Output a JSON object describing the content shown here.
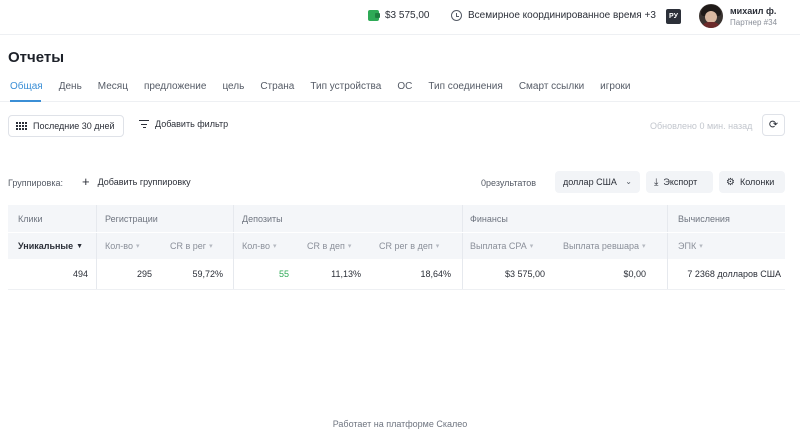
{
  "topbar": {
    "balance": "$3 575,00",
    "timezone": "Всемирное координированное время +3",
    "lang": "РУ",
    "user_name": "михаил ф.",
    "user_role": "Партнер #34"
  },
  "page": {
    "title": "Отчеты",
    "tabs": [
      "Общая",
      "День",
      "Месяц",
      "предложение",
      "цель",
      "Страна",
      "Тип устройства",
      "ОС",
      "Тип соединения",
      "Смарт ссылки",
      "игроки"
    ],
    "active_tab": "Общая"
  },
  "filters": {
    "date_range": "Последние 30 дней",
    "add_filter": "Добавить фильтр",
    "updated": "Обновлено 0 мин. назад"
  },
  "toolbar": {
    "grouping_label": "Группировка:",
    "add_grouping": "Добавить группировку",
    "results": "0результатов",
    "currency": "доллар США",
    "export": "Экспорт",
    "columns": "Колонки"
  },
  "table": {
    "groups": [
      "Клики",
      "Регистрации",
      "Депозиты",
      "Финансы",
      "Вычисления"
    ],
    "columns": [
      "Уникальные",
      "Кол-во",
      "CR в рег",
      "Кол-во",
      "CR в деп",
      "CR рег в деп",
      "Выплата CPA",
      "Выплата ревшара",
      "ЭПК"
    ],
    "row": [
      "494",
      "295",
      "59,72%",
      "55",
      "11,13%",
      "18,64%",
      "$3 575,00",
      "$0,00",
      "7 2368 долларов США"
    ]
  },
  "footer": {
    "text": "Работает на платформе Скалео"
  },
  "colors": {
    "accent": "#3b8fd6",
    "positive": "#2eaa56"
  }
}
